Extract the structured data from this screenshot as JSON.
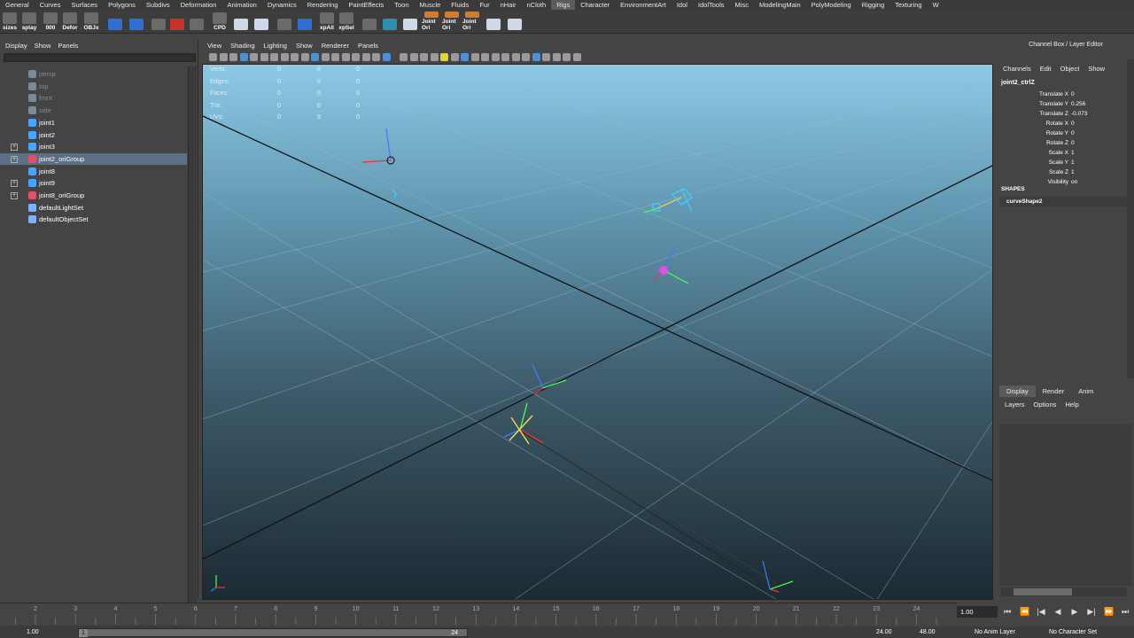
{
  "shelf_tabs": [
    "General",
    "Curves",
    "Surfaces",
    "Polygons",
    "Subdivs",
    "Deformation",
    "Animation",
    "Dynamics",
    "Rendering",
    "PaintEffects",
    "Toon",
    "Muscle",
    "Fluids",
    "Fur",
    "nHair",
    "nCloth",
    "Rigs",
    "Character",
    "EnvironmentArt",
    "Idol",
    "IdolTools",
    "Misc",
    "ModelingMain",
    "PolyModeling",
    "Rigging",
    "Texturing",
    "W"
  ],
  "active_shelf_tab": "Rigs",
  "shelf_buttons": [
    {
      "label": "sizes",
      "icon": "joint-size-icon",
      "color": "gray"
    },
    {
      "label": "splay",
      "icon": "splay-icon",
      "color": "gray"
    },
    {
      "label": "000",
      "icon": "zero-icon",
      "color": "gray"
    },
    {
      "label": "Defor",
      "icon": "deform-icon",
      "color": "gray"
    },
    {
      "label": "OBJx",
      "icon": "object-icon",
      "color": "gray"
    },
    {
      "label": "",
      "icon": "blue-can-icon",
      "color": "blue"
    },
    {
      "label": "",
      "icon": "sphere-tool-icon",
      "color": "blue"
    },
    {
      "label": "",
      "icon": "joint-tool-icon",
      "color": "gray"
    },
    {
      "label": "",
      "icon": "red-constraint-icon",
      "color": "red"
    },
    {
      "label": "",
      "icon": "gear-icon",
      "color": "gray"
    },
    {
      "label": "CPD",
      "icon": "cpd-icon",
      "color": "gray"
    },
    {
      "label": "",
      "icon": "movie-icon",
      "color": "light"
    },
    {
      "label": "",
      "icon": "movie2-icon",
      "color": "light"
    },
    {
      "label": "",
      "icon": "joint-tool-icon",
      "color": "gray"
    },
    {
      "label": "",
      "icon": "script-icon",
      "color": "blue"
    },
    {
      "label": "xpAll",
      "icon": "xp-all-icon",
      "color": "gray"
    },
    {
      "label": "xpSel",
      "icon": "xp-sel-icon",
      "color": "gray"
    },
    {
      "label": "",
      "icon": "joint-tool-icon",
      "color": "gray"
    },
    {
      "label": "",
      "icon": "sphere-icon",
      "color": "teal"
    },
    {
      "label": "",
      "icon": "window-icon",
      "color": "light"
    },
    {
      "label": "Joint Ori",
      "icon": "joint-orient-icon",
      "color": "orange"
    },
    {
      "label": "Joint Ori",
      "icon": "joint-orient-icon",
      "color": "orange"
    },
    {
      "label": "Joint Ori",
      "icon": "joint-orient-icon",
      "color": "orange"
    },
    {
      "label": "",
      "icon": "axis-icon",
      "color": "light"
    },
    {
      "label": "",
      "icon": "axis-icon",
      "color": "light"
    }
  ],
  "outliner": {
    "menu": [
      "Display",
      "Show",
      "Panels"
    ],
    "items": [
      {
        "label": "persp",
        "icon": "camera-icon",
        "dim": true,
        "expand": false,
        "selected": false
      },
      {
        "label": "top",
        "icon": "camera-icon",
        "dim": true,
        "expand": false,
        "selected": false
      },
      {
        "label": "front",
        "icon": "camera-icon",
        "dim": true,
        "expand": false,
        "selected": false
      },
      {
        "label": "side",
        "icon": "camera-icon",
        "dim": true,
        "expand": false,
        "selected": false
      },
      {
        "label": "joint1",
        "icon": "joint-icon",
        "dim": false,
        "expand": false,
        "selected": false
      },
      {
        "label": "joint2",
        "icon": "joint-icon",
        "dim": false,
        "expand": false,
        "selected": false
      },
      {
        "label": "joint3",
        "icon": "joint-icon",
        "dim": false,
        "expand": true,
        "selected": false
      },
      {
        "label": "joint2_oriGroup",
        "icon": "group-icon",
        "dim": false,
        "expand": true,
        "selected": true
      },
      {
        "label": "joint8",
        "icon": "joint-icon",
        "dim": false,
        "expand": false,
        "selected": false
      },
      {
        "label": "joint9",
        "icon": "joint-icon",
        "dim": false,
        "expand": true,
        "selected": false
      },
      {
        "label": "joint8_oriGroup",
        "icon": "group-icon",
        "dim": false,
        "expand": true,
        "selected": false
      },
      {
        "label": "defaultLightSet",
        "icon": "set-icon",
        "dim": false,
        "expand": false,
        "selected": false
      },
      {
        "label": "defaultObjectSet",
        "icon": "set-icon",
        "dim": false,
        "expand": false,
        "selected": false
      }
    ]
  },
  "viewport": {
    "menu": [
      "View",
      "Shading",
      "Lighting",
      "Show",
      "Renderer",
      "Panels"
    ],
    "hud": [
      {
        "label": "Verts:",
        "v1": "0",
        "v2": "0",
        "v3": "0"
      },
      {
        "label": "Edges:",
        "v1": "0",
        "v2": "0",
        "v3": "0"
      },
      {
        "label": "Faces:",
        "v1": "0",
        "v2": "0",
        "v3": "0"
      },
      {
        "label": "Tris:",
        "v1": "0",
        "v2": "0",
        "v3": "0"
      },
      {
        "label": "UVs:",
        "v1": "0",
        "v2": "0",
        "v3": "0"
      }
    ]
  },
  "channel_box": {
    "title": "Channel Box / Layer Editor",
    "menu": [
      "Channels",
      "Edit",
      "Object",
      "Show"
    ],
    "object": "joint2_ctrlZ",
    "attributes": [
      {
        "name": "Translate X",
        "value": "0"
      },
      {
        "name": "Translate Y",
        "value": "0.256"
      },
      {
        "name": "Translate Z",
        "value": "-0.073"
      },
      {
        "name": "Rotate X",
        "value": "0"
      },
      {
        "name": "Rotate Y",
        "value": "0"
      },
      {
        "name": "Rotate Z",
        "value": "0"
      },
      {
        "name": "Scale X",
        "value": "1"
      },
      {
        "name": "Scale Y",
        "value": "1"
      },
      {
        "name": "Scale Z",
        "value": "1"
      },
      {
        "name": "Visibility",
        "value": "on"
      }
    ],
    "shapes_header": "SHAPES",
    "shape": "curveShape2"
  },
  "layer_editor": {
    "tabs": [
      "Display",
      "Render",
      "Anim"
    ],
    "active_tab": "Display",
    "menu": [
      "Layers",
      "Options",
      "Help"
    ]
  },
  "time_slider": {
    "ticks": [
      "2",
      "3",
      "4",
      "5",
      "6",
      "7",
      "8",
      "9",
      "10",
      "11",
      "12",
      "13",
      "14",
      "15",
      "16",
      "17",
      "18",
      "19",
      "20",
      "21",
      "22",
      "23",
      "24"
    ],
    "current_time": "1.00"
  },
  "range_slider": {
    "start": "1.00",
    "range_start": "1",
    "range_end": "24",
    "end": "24.00",
    "total_end": "48.00",
    "anim_layer": "No Anim Layer",
    "character_set": "No Character Set"
  },
  "colors": {
    "accent_selection": "#5d6f86",
    "viewport_sky": "#8cc9e6",
    "viewport_ground": "#1c2a33"
  }
}
